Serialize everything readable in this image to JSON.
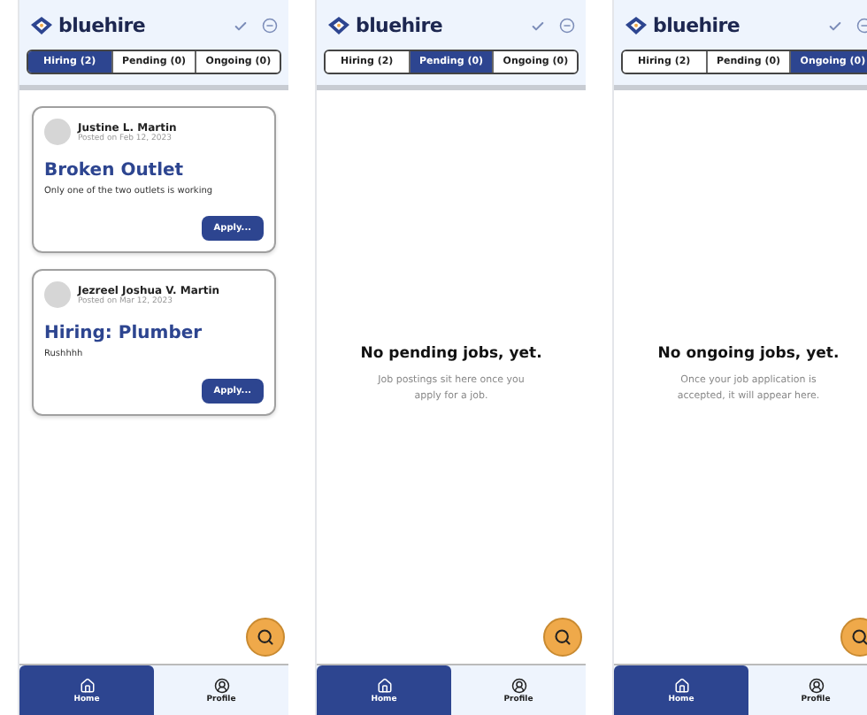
{
  "screens": [
    {
      "brand": "bluehire",
      "tabs": [
        {
          "label": "Hiring (2)",
          "selected": true
        },
        {
          "label": "Pending (0)",
          "selected": false
        },
        {
          "label": "Ongoing (0)",
          "selected": false
        }
      ],
      "content": {
        "kind": "list",
        "jobs": [
          {
            "name": "Justine L. Martin",
            "date": "Posted on Feb 12, 2023",
            "title": "Broken Outlet",
            "description": "Only one of the two outlets is working",
            "action": "Apply..."
          },
          {
            "name": "Jezreel Joshua V. Martin",
            "date": "Posted on Mar 12, 2023",
            "title": "Hiring: Plumber",
            "description": "Rushhhh",
            "action": "Apply..."
          }
        ]
      },
      "nav": [
        {
          "label": "Home",
          "selected": true
        },
        {
          "label": "Profile",
          "selected": false
        }
      ]
    },
    {
      "brand": "bluehire",
      "tabs": [
        {
          "label": "Hiring (2)",
          "selected": false
        },
        {
          "label": "Pending (0)",
          "selected": true
        },
        {
          "label": "Ongoing (0)",
          "selected": false
        }
      ],
      "content": {
        "kind": "empty",
        "title": "No pending jobs, yet.",
        "message": "Job postings sit here once you apply for a job."
      },
      "nav": [
        {
          "label": "Home",
          "selected": true
        },
        {
          "label": "Profile",
          "selected": false
        }
      ]
    },
    {
      "brand": "bluehire",
      "tabs": [
        {
          "label": "Hiring (2)",
          "selected": false
        },
        {
          "label": "Pending (0)",
          "selected": false
        },
        {
          "label": "Ongoing (0)",
          "selected": true
        }
      ],
      "content": {
        "kind": "empty",
        "title": "No ongoing jobs, yet.",
        "message": "Once your job application is accepted, it will appear here."
      },
      "nav": [
        {
          "label": "Home",
          "selected": true
        },
        {
          "label": "Profile",
          "selected": false
        }
      ]
    }
  ]
}
